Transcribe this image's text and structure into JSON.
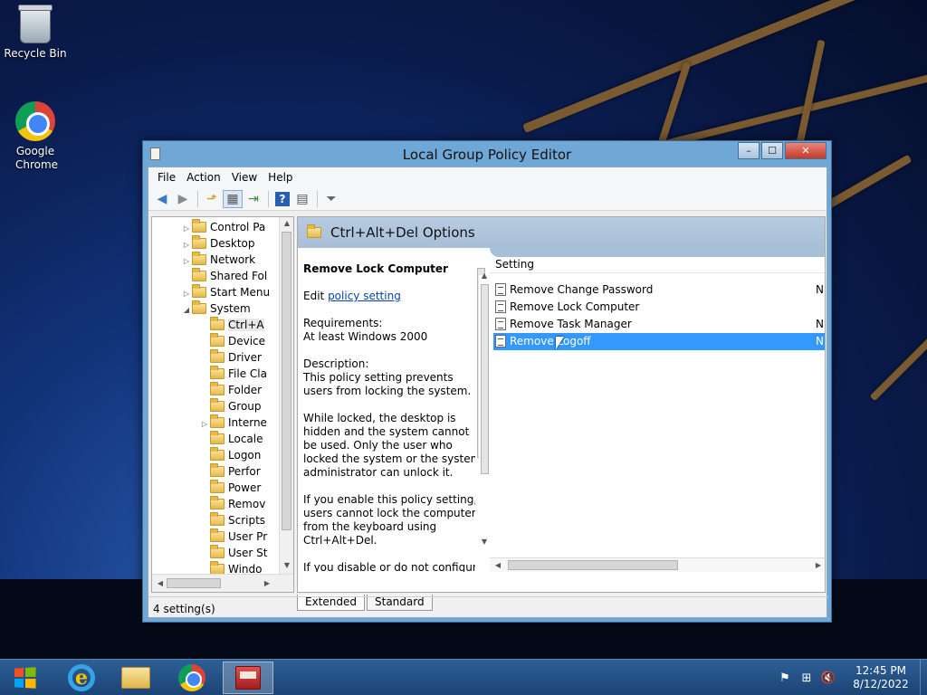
{
  "desktop": {
    "icons": [
      {
        "label": "Recycle Bin",
        "icon": "recycle-bin-icon"
      },
      {
        "label": "Google Chrome",
        "icon": "chrome-icon"
      }
    ]
  },
  "window": {
    "title": "Local Group Policy Editor",
    "controls": {
      "minimize": "–",
      "maximize": "☐",
      "close": "✕"
    },
    "menu": [
      "File",
      "Action",
      "View",
      "Help"
    ],
    "toolbar": {
      "icons": [
        "back-icon",
        "forward-icon",
        "up-folder-icon",
        "show-hide-tree-icon",
        "export-list-icon",
        "help-icon",
        "properties-icon",
        "filter-icon"
      ],
      "glyphs": {
        "back": "◀",
        "forward": "▶",
        "up": "⬏",
        "tree": "▦",
        "export": "⇥",
        "help": "?",
        "props": "▤",
        "filter": "⏷"
      }
    },
    "tree": {
      "items": [
        {
          "label": "Control Pa",
          "expander": "▷"
        },
        {
          "label": "Desktop",
          "expander": "▷"
        },
        {
          "label": "Network",
          "expander": "▷"
        },
        {
          "label": "Shared Fol",
          "expander": ""
        },
        {
          "label": "Start Menu",
          "expander": "▷"
        },
        {
          "label": "System",
          "expander": "◢"
        },
        {
          "label": "Ctrl+A",
          "expander": ""
        },
        {
          "label": "Device",
          "expander": ""
        },
        {
          "label": "Driver",
          "expander": ""
        },
        {
          "label": "File Cla",
          "expander": ""
        },
        {
          "label": "Folder",
          "expander": ""
        },
        {
          "label": "Group",
          "expander": ""
        },
        {
          "label": "Interne",
          "expander": "▷"
        },
        {
          "label": "Locale",
          "expander": ""
        },
        {
          "label": "Logon",
          "expander": ""
        },
        {
          "label": "Perfor",
          "expander": ""
        },
        {
          "label": "Power",
          "expander": ""
        },
        {
          "label": "Remov",
          "expander": ""
        },
        {
          "label": "Scripts",
          "expander": ""
        },
        {
          "label": "User Pr",
          "expander": ""
        },
        {
          "label": "User St",
          "expander": ""
        },
        {
          "label": "Windo",
          "expander": ""
        }
      ],
      "selected_index": 6
    },
    "details_header": "Ctrl+Alt+Del Options",
    "description": {
      "title": "Remove Lock Computer",
      "edit_prefix": "Edit ",
      "edit_link": "policy setting ",
      "requirements_label": "Requirements:",
      "requirements_value": "At least Windows 2000",
      "description_label": "Description:",
      "description_text": "This policy setting prevents users from locking the system.",
      "para2": "While locked, the desktop is hidden and the system cannot be used. Only the user who locked the system or the system administrator can unlock it.",
      "para3": "If you enable this policy setting, users cannot lock the computer from the keyboard using Ctrl+Alt+Del.",
      "para4": "If you disable or do not configure"
    },
    "list": {
      "column_setting": "Setting",
      "rows": [
        {
          "name": "Remove Change Password",
          "state": "N"
        },
        {
          "name": "Remove Lock Computer",
          "state": ""
        },
        {
          "name": "Remove Task Manager",
          "state": "N"
        },
        {
          "name": "Remove Logoff",
          "state": "N"
        }
      ],
      "selected_index": 3
    },
    "tabs": [
      "Extended",
      "Standard"
    ],
    "active_tab": 0,
    "status": "4 setting(s)",
    "scroll_glyphs": {
      "up": "▲",
      "down": "▼",
      "left": "◀",
      "right": "▶",
      "grip": "⦀"
    }
  },
  "taskbar": {
    "start_colors": [
      "#f25022",
      "#7fba00",
      "#00a4ef",
      "#ffb900"
    ],
    "apps": [
      {
        "name": "Internet Explorer",
        "icon": "ie-icon"
      },
      {
        "name": "File Explorer",
        "icon": "file-explorer-icon"
      },
      {
        "name": "Google Chrome",
        "icon": "chrome-icon"
      },
      {
        "name": "Local Group Policy Editor",
        "icon": "group-policy-icon",
        "active": true
      }
    ],
    "tray": {
      "flag": "⚑",
      "network": "⊞",
      "volume": "🔇",
      "time": "12:45 PM",
      "date": "8/12/2022"
    }
  }
}
